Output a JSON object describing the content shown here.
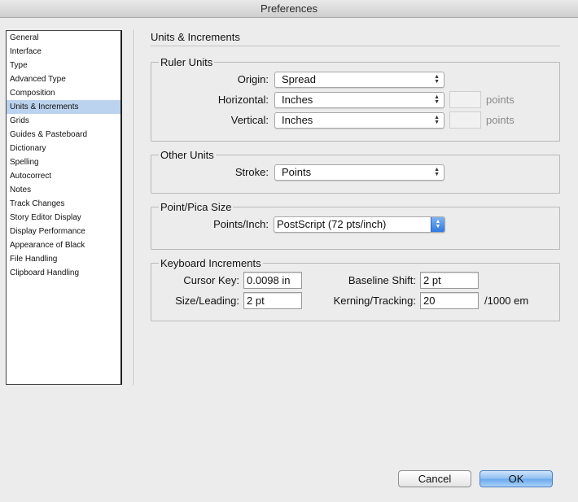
{
  "window": {
    "title": "Preferences"
  },
  "sidebar": {
    "items": [
      "General",
      "Interface",
      "Type",
      "Advanced Type",
      "Composition",
      "Units & Increments",
      "Grids",
      "Guides & Pasteboard",
      "Dictionary",
      "Spelling",
      "Autocorrect",
      "Notes",
      "Track Changes",
      "Story Editor Display",
      "Display Performance",
      "Appearance of Black",
      "File Handling",
      "Clipboard Handling"
    ],
    "selected": "Units & Increments"
  },
  "panel": {
    "title": "Units & Increments"
  },
  "ruler_units": {
    "title": "Ruler Units",
    "origin_label": "Origin:",
    "origin_value": "Spread",
    "horizontal_label": "Horizontal:",
    "horizontal_value": "Inches",
    "horizontal_custom": "",
    "horizontal_unit": "points",
    "vertical_label": "Vertical:",
    "vertical_value": "Inches",
    "vertical_custom": "",
    "vertical_unit": "points"
  },
  "other_units": {
    "title": "Other Units",
    "stroke_label": "Stroke:",
    "stroke_value": "Points"
  },
  "point_pica": {
    "title": "Point/Pica Size",
    "points_inch_label": "Points/Inch:",
    "points_inch_value": "PostScript (72 pts/inch)"
  },
  "keyboard_increments": {
    "title": "Keyboard Increments",
    "cursor_key_label": "Cursor Key:",
    "cursor_key_value": "0.0098 in",
    "baseline_shift_label": "Baseline Shift:",
    "baseline_shift_value": "2 pt",
    "size_leading_label": "Size/Leading:",
    "size_leading_value": "2 pt",
    "kerning_tracking_label": "Kerning/Tracking:",
    "kerning_tracking_value": "20",
    "kerning_unit": "/1000 em"
  },
  "buttons": {
    "cancel": "Cancel",
    "ok": "OK"
  },
  "icons": {
    "select_arrows": "updown-arrows-icon"
  },
  "colors": {
    "selection": "#bcd3ef",
    "accent": "#6aa8ec"
  }
}
